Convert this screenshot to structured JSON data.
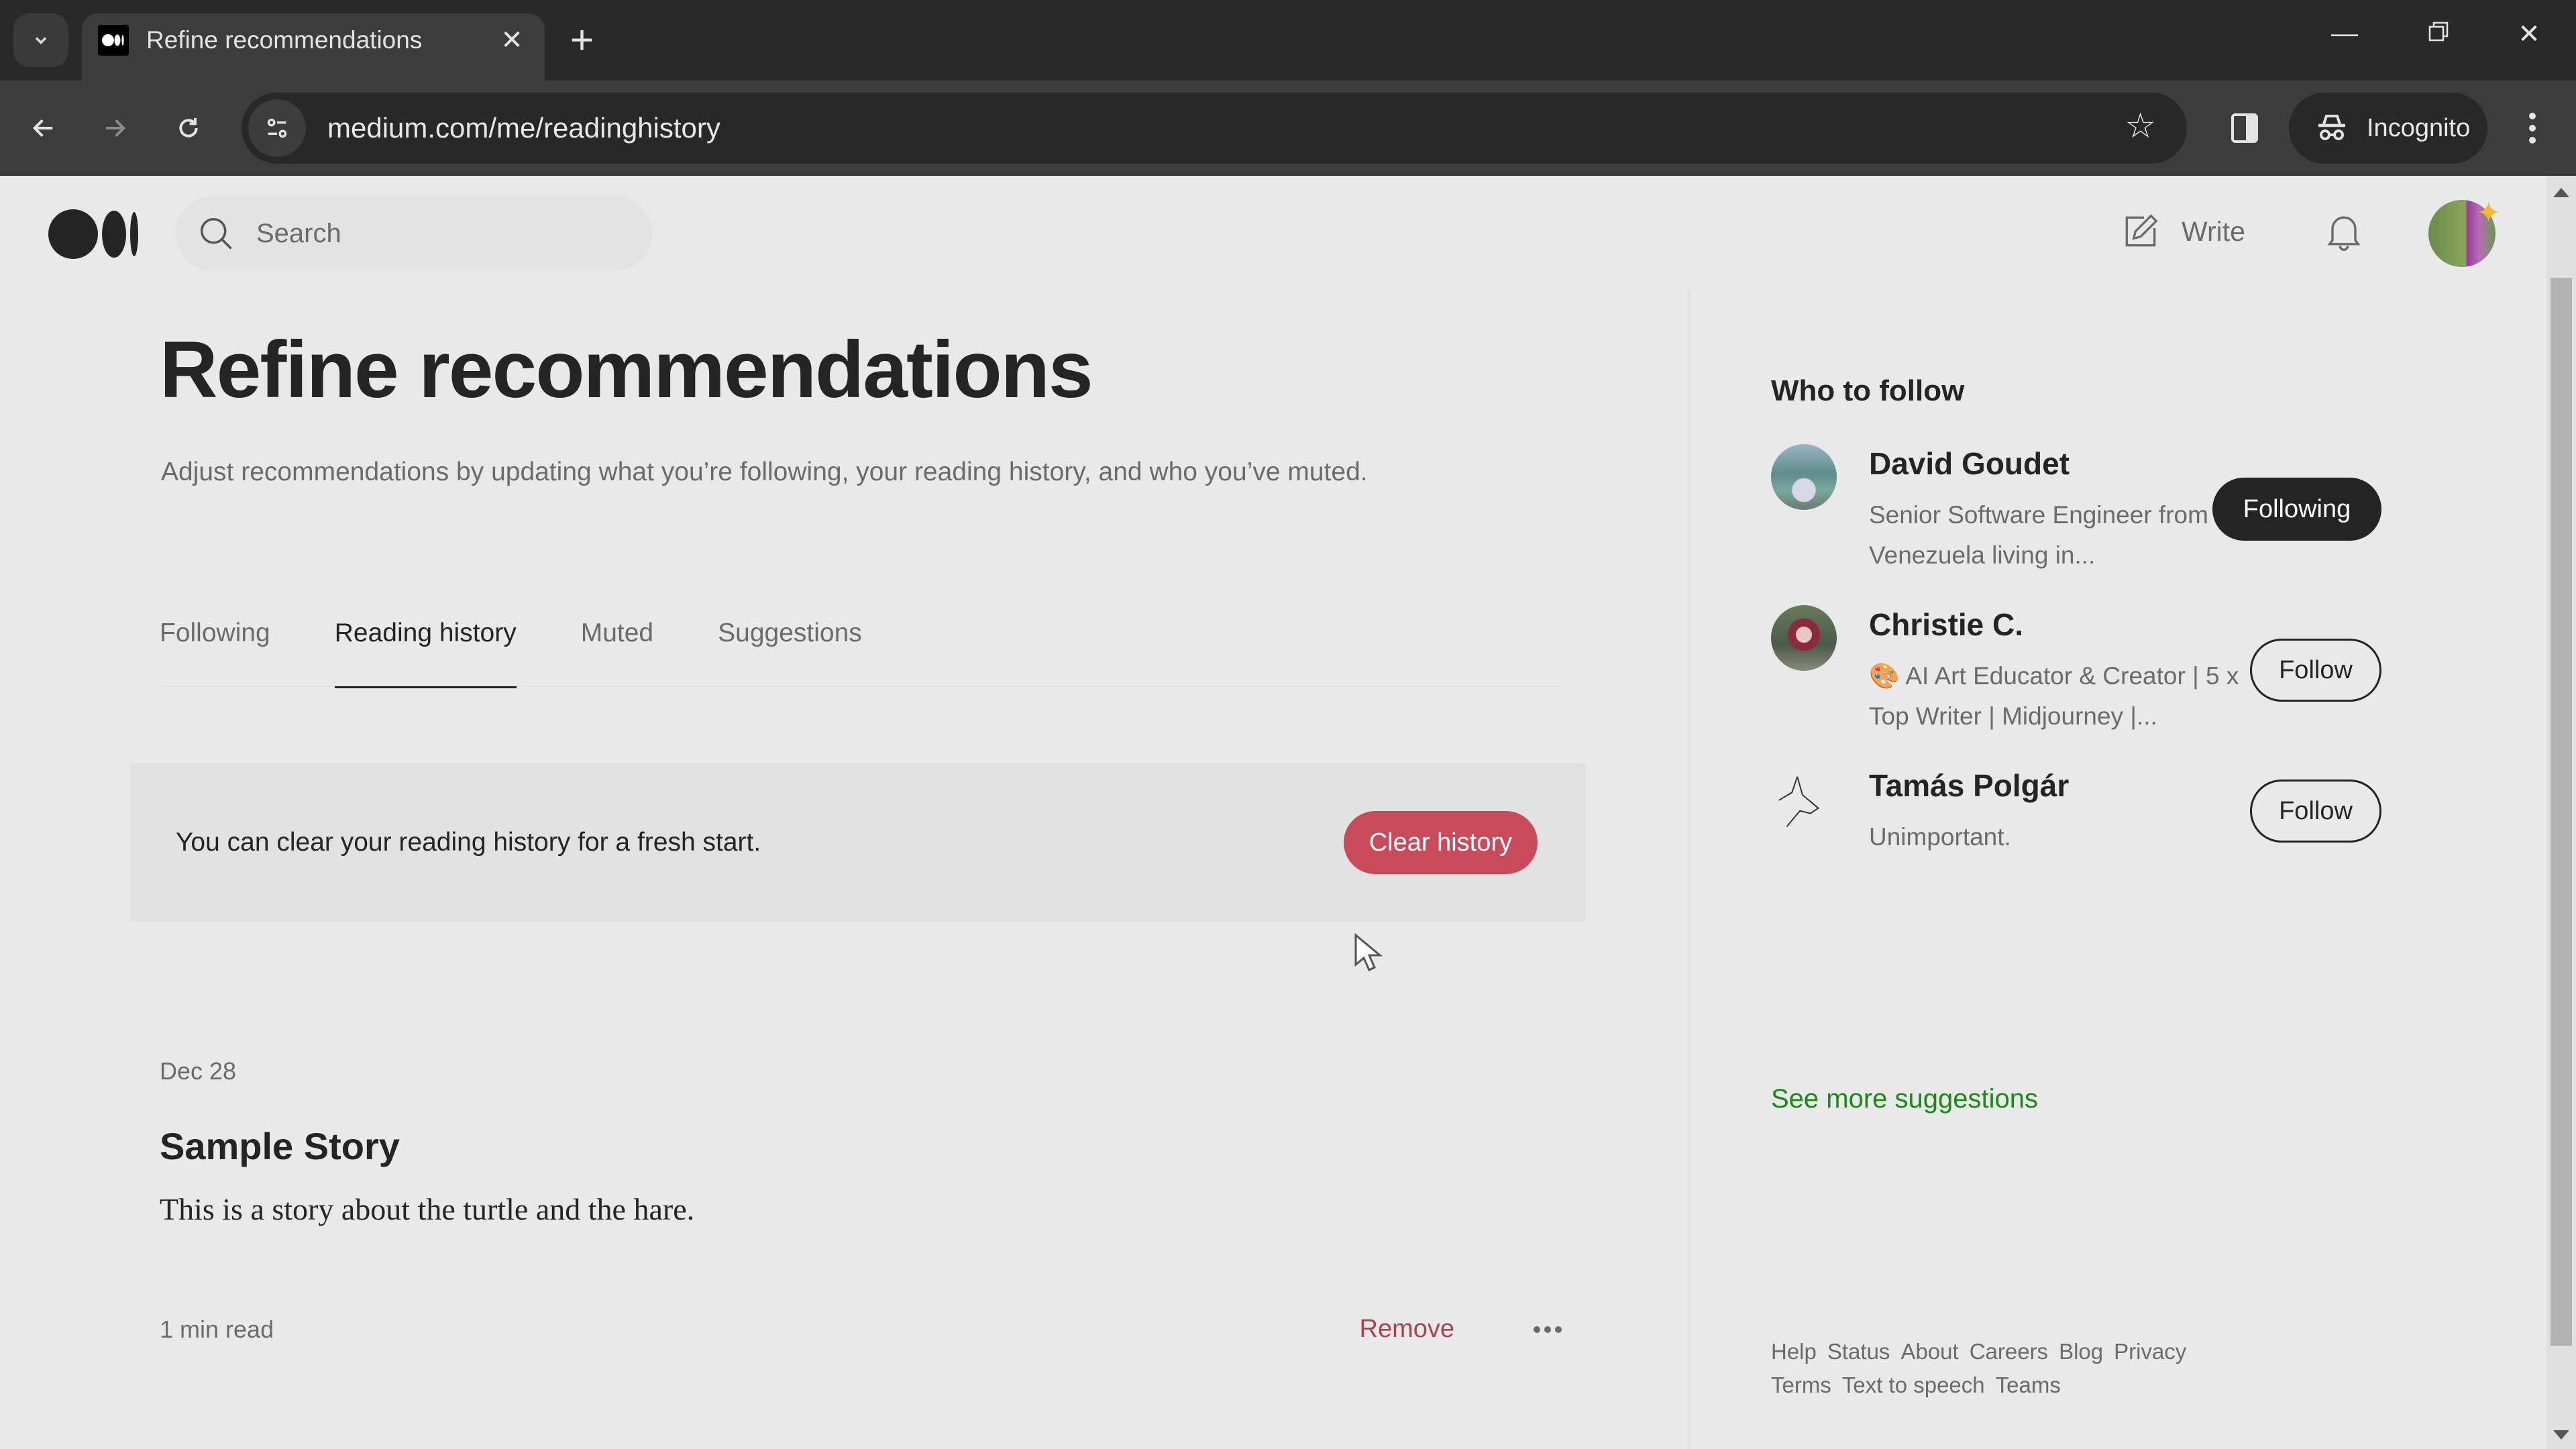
{
  "browser": {
    "tab_title": "Refine recommendations",
    "url": "medium.com/me/readinghistory",
    "incognito_label": "Incognito",
    "icons": {
      "tab_search": "chevron-down-icon",
      "close_tab": "close-icon",
      "new_tab": "plus-icon",
      "minimize": "minimize-icon",
      "restore": "restore-icon",
      "close_window": "close-icon",
      "back": "arrow-left-icon",
      "forward": "arrow-right-icon",
      "reload": "reload-icon",
      "site_info": "tune-icon",
      "bookmark": "star-icon",
      "side_panel": "side-panel-icon",
      "incognito": "incognito-icon",
      "menu": "kebab-icon"
    }
  },
  "header": {
    "search_placeholder": "Search",
    "write_label": "Write"
  },
  "main": {
    "title": "Refine recommendations",
    "subtitle": "Adjust recommendations by updating what you’re following, your reading history, and who you’ve muted.",
    "tabs": [
      {
        "label": "Following",
        "active": false
      },
      {
        "label": "Reading history",
        "active": true
      },
      {
        "label": "Muted",
        "active": false
      },
      {
        "label": "Suggestions",
        "active": false
      }
    ],
    "clear_notice": "You can clear your reading history for a fresh start.",
    "clear_button": "Clear history",
    "stories": [
      {
        "date": "Dec 28",
        "title": "Sample Story",
        "excerpt": "This is a story about the turtle and the hare.",
        "read_time": "1 min read",
        "remove_label": "Remove"
      }
    ]
  },
  "sidebar": {
    "title": "Who to follow",
    "people": [
      {
        "name": "David Goudet",
        "bio": "Senior Software Engineer from Venezuela living in...",
        "button": "Following"
      },
      {
        "name": "Christie C.",
        "bio_emoji": "🎨",
        "bio": "AI Art Educator & Creator | 5 x Top Writer | Midjourney |...",
        "button": "Follow"
      },
      {
        "name": "Tamás Polgár",
        "bio": "Unimportant.",
        "button": "Follow"
      }
    ],
    "see_more": "See more suggestions",
    "footer_links": [
      "Help",
      "Status",
      "About",
      "Careers",
      "Blog",
      "Privacy",
      "Terms",
      "Text to speech",
      "Teams"
    ]
  },
  "colors": {
    "accent_green": "#1a8917",
    "danger_red": "#c94a5a",
    "text_primary": "#242424",
    "text_secondary": "#6b6b6b"
  }
}
